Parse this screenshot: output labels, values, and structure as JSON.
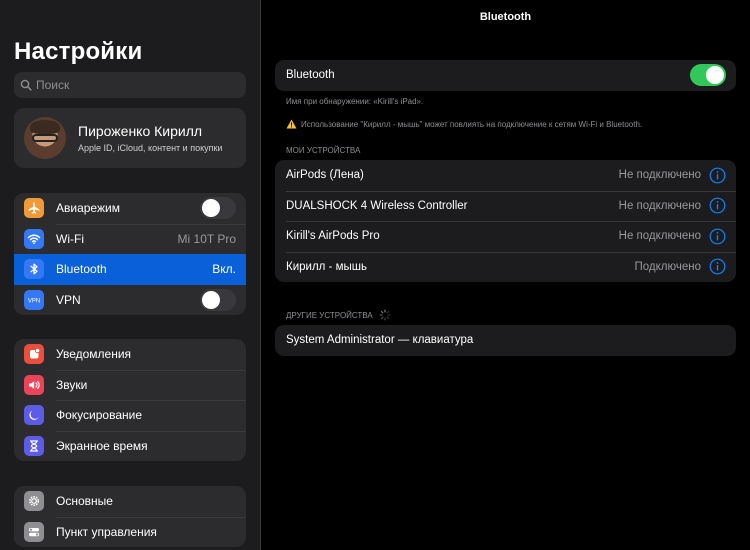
{
  "sidebar": {
    "title": "Настройки",
    "search_placeholder": "Поиск",
    "profile": {
      "name": "Пироженко Кирилл",
      "subtitle": "Apple ID, iCloud, контент и покупки"
    },
    "group1": [
      {
        "label": "Авиарежим",
        "icon": "airplane-icon",
        "color": "#f09a37",
        "toggle": false
      },
      {
        "label": "Wi-Fi",
        "icon": "wifi-icon",
        "color": "#3478f6",
        "value": "Mi 10T Pro"
      },
      {
        "label": "Bluetooth",
        "icon": "bluetooth-icon",
        "color": "#3478f6",
        "value": "Вкл.",
        "selected": true
      },
      {
        "label": "VPN",
        "icon": "vpn-icon",
        "color": "#3478f6",
        "toggle": false
      }
    ],
    "group2": [
      {
        "label": "Уведомления",
        "icon": "notifications-icon",
        "color": "#eb4e3d"
      },
      {
        "label": "Звуки",
        "icon": "sounds-icon",
        "color": "#eb445a"
      },
      {
        "label": "Фокусирование",
        "icon": "moon-icon",
        "color": "#5e5ce6"
      },
      {
        "label": "Экранное время",
        "icon": "hourglass-icon",
        "color": "#5e5ce6"
      }
    ],
    "group3": [
      {
        "label": "Основные",
        "icon": "gear-icon",
        "color": "#8e8e93"
      },
      {
        "label": "Пункт управления",
        "icon": "control-center-icon",
        "color": "#8e8e93"
      }
    ]
  },
  "main": {
    "title": "Bluetooth",
    "bluetooth_label": "Bluetooth",
    "bluetooth_on": true,
    "discovery_note": "Имя при обнаружении: «Kirill's iPad».",
    "warning_note": "Использование \"Кирилл - мышь\" может повлиять на подключение к сетям Wi-Fi и Bluetooth.",
    "my_devices_header": "МОИ УСТРОЙСТВА",
    "my_devices": [
      {
        "name": "AirPods (Лена)",
        "status": "Не подключено"
      },
      {
        "name": "DUALSHOCK 4 Wireless Controller",
        "status": "Не подключено"
      },
      {
        "name": "Kirill's AirPods Pro",
        "status": "Не подключено"
      },
      {
        "name": "Кирилл - мышь",
        "status": "Подключено"
      }
    ],
    "other_devices_header": "ДРУГИЕ УСТРОЙСТВА",
    "other_devices": [
      {
        "name": "System Administrator — клавиатура"
      }
    ]
  },
  "colors": {
    "accent": "#0a84ff",
    "toggle_on": "#32c759",
    "selected": "#0a60d8"
  }
}
